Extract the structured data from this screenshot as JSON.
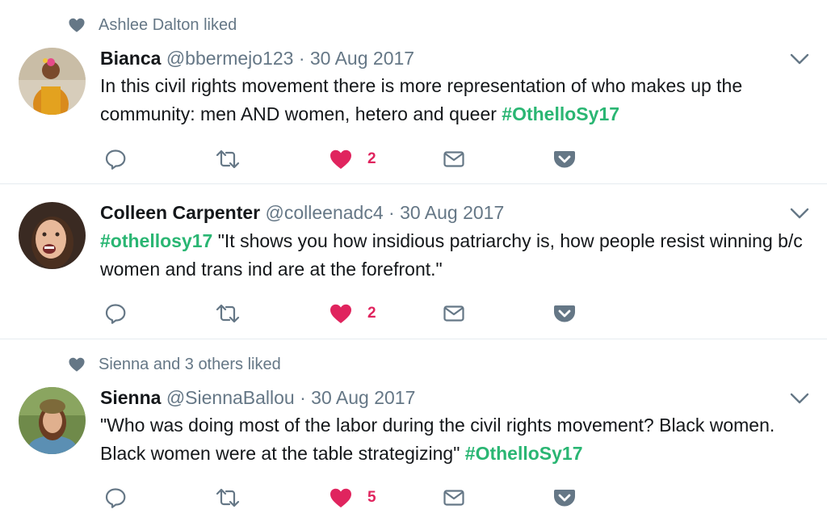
{
  "tweets": [
    {
      "context": "Ashlee Dalton liked",
      "name": "Bianca",
      "handle": "@bbermejo123",
      "sep": " · ",
      "date": "30 Aug 2017",
      "text_plain": "In this civil rights movement there is more representation of who makes up the community: men AND women, hetero and queer ",
      "hashtag": "#OthelloSy17",
      "likes": "2"
    },
    {
      "context": "",
      "name": "Colleen Carpenter",
      "handle": "@colleenadc4",
      "sep": " · ",
      "date": "30 Aug 2017",
      "hashtag": "#othellosy17",
      "text_plain": " \"It shows you how insidious patriarchy is, how people resist winning b/c women and trans ind are at the forefront.\"",
      "likes": "2"
    },
    {
      "context": "Sienna and 3 others liked",
      "name": "Sienna",
      "handle": "@SiennaBallou",
      "sep": " · ",
      "date": "30 Aug 2017",
      "text_plain": "\"Who was doing most of the labor during the civil rights movement? Black women. Black women were at the table strategizing\" ",
      "hashtag": "#OthelloSy17",
      "likes": "5"
    }
  ],
  "icons": {
    "context": "heart-icon",
    "reply": "reply-icon",
    "retweet": "retweet-icon",
    "like": "heart-icon",
    "dm": "envelope-icon",
    "save": "pocket-icon",
    "caret": "chevron-down-icon"
  },
  "colors": {
    "hashtag": "#2ab673",
    "like": "#e0245e",
    "secondary": "#657786",
    "text": "#14171a",
    "divider": "#e6ecf0",
    "icon": "#657786"
  }
}
